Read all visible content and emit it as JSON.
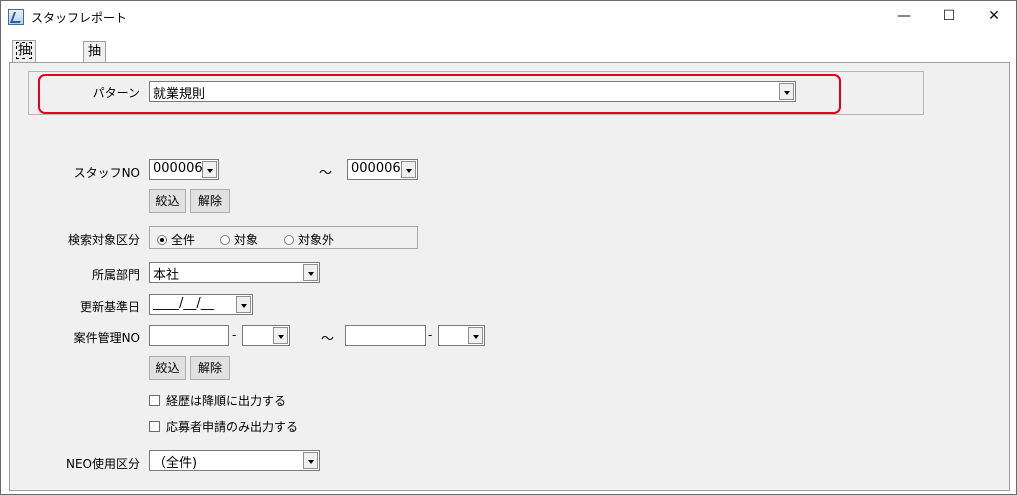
{
  "window": {
    "title": "スタッフレポート",
    "minimize_glyph": "—",
    "maximize_glyph": "☐",
    "close_glyph": "✕"
  },
  "tabs": [
    {
      "label": "抽出条件",
      "active": true
    },
    {
      "label": "抽出結果",
      "active": false
    }
  ],
  "pattern": {
    "label": "パターン",
    "value": "就業規則"
  },
  "staff_no": {
    "label": "スタッフNO",
    "from": "000006",
    "tilde": "～",
    "to": "000006"
  },
  "filter_buttons_1": {
    "narrow": "絞込",
    "clear": "解除"
  },
  "search_target": {
    "label": "検索対象区分",
    "options": [
      {
        "label": "全件",
        "selected": true
      },
      {
        "label": "対象",
        "selected": false
      },
      {
        "label": "対象外",
        "selected": false
      }
    ]
  },
  "department": {
    "label": "所属部門",
    "value": "本社"
  },
  "base_date": {
    "label": "更新基準日",
    "value": "____/__/__"
  },
  "case_no": {
    "label": "案件管理NO",
    "dash": "-",
    "tilde": "～"
  },
  "filter_buttons_2": {
    "narrow": "絞込",
    "clear": "解除"
  },
  "options": {
    "desc_order": "経歴は降順に出力する",
    "applicants_only": "応募者申請のみ出力する"
  },
  "neo": {
    "label": "NEO使用区分",
    "value": "（全件)"
  },
  "colors": {
    "highlight": "#e6001f",
    "panel": "#f0f0f0"
  }
}
